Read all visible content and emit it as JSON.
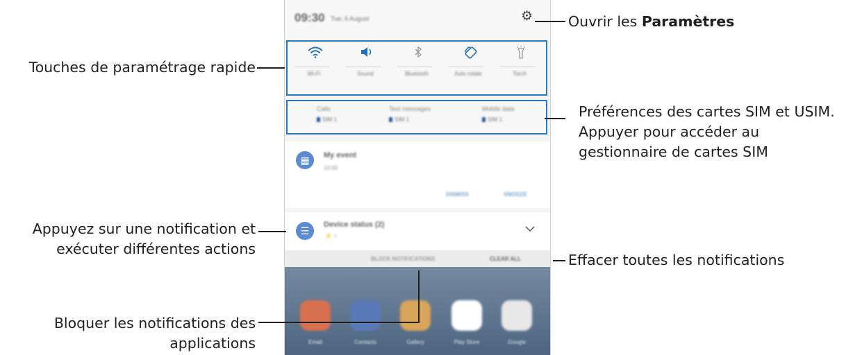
{
  "annotations": {
    "settings_prefix": "Ouvrir les ",
    "settings_bold": "Paramètres",
    "quick_settings": "Touches de paramétrage rapide",
    "sim_line1": "Préférences des cartes SIM et USIM.",
    "sim_line2": "Appuyer pour accéder au",
    "sim_line3": "gestionnaire de cartes SIM",
    "notification_line1": "Appuyez sur une notification et",
    "notification_line2": "exécuter différentes actions",
    "clear_all": "Effacer toutes les notifications",
    "block_line1": "Bloquer les notifications des",
    "block_line2": "applications"
  },
  "status_bar": {
    "time": "09:30",
    "date": "Tue, 6 August",
    "settings_icon": "gear-icon"
  },
  "quick_settings": [
    {
      "icon": "wifi-icon",
      "glyph": "◠",
      "label": "Wi-Fi"
    },
    {
      "icon": "sound-icon",
      "glyph": "◀)",
      "label": "Sound"
    },
    {
      "icon": "bluetooth-icon",
      "glyph": "✱",
      "label": "Bluetooth"
    },
    {
      "icon": "auto-rotate-icon",
      "glyph": "⟳",
      "label": "Auto rotate"
    },
    {
      "icon": "torch-icon",
      "glyph": "ǐ",
      "label": "Torch"
    }
  ],
  "sim_prefs": [
    {
      "title": "Calls",
      "value": "SIM 1"
    },
    {
      "title": "Text messages",
      "value": "SIM 1"
    },
    {
      "title": "Mobile data",
      "value": "SIM 1"
    }
  ],
  "event_card": {
    "icon": "calendar-icon",
    "title": "My event",
    "time": "10:00",
    "dismiss": "DISMISS",
    "snooze": "SNOOZE"
  },
  "device_card": {
    "icon": "list-icon",
    "title": "Device status (2)",
    "sub": "⚡ ♆",
    "expand_icon": "chevron-down-icon"
  },
  "actions": {
    "block": "BLOCK NOTIFICATIONS",
    "clear": "CLEAR ALL"
  },
  "home_apps": [
    "Email",
    "Contacts",
    "Gallery",
    "Play Store",
    "Google"
  ],
  "colors": {
    "accent": "#2b76b9",
    "text": "#231f20"
  }
}
